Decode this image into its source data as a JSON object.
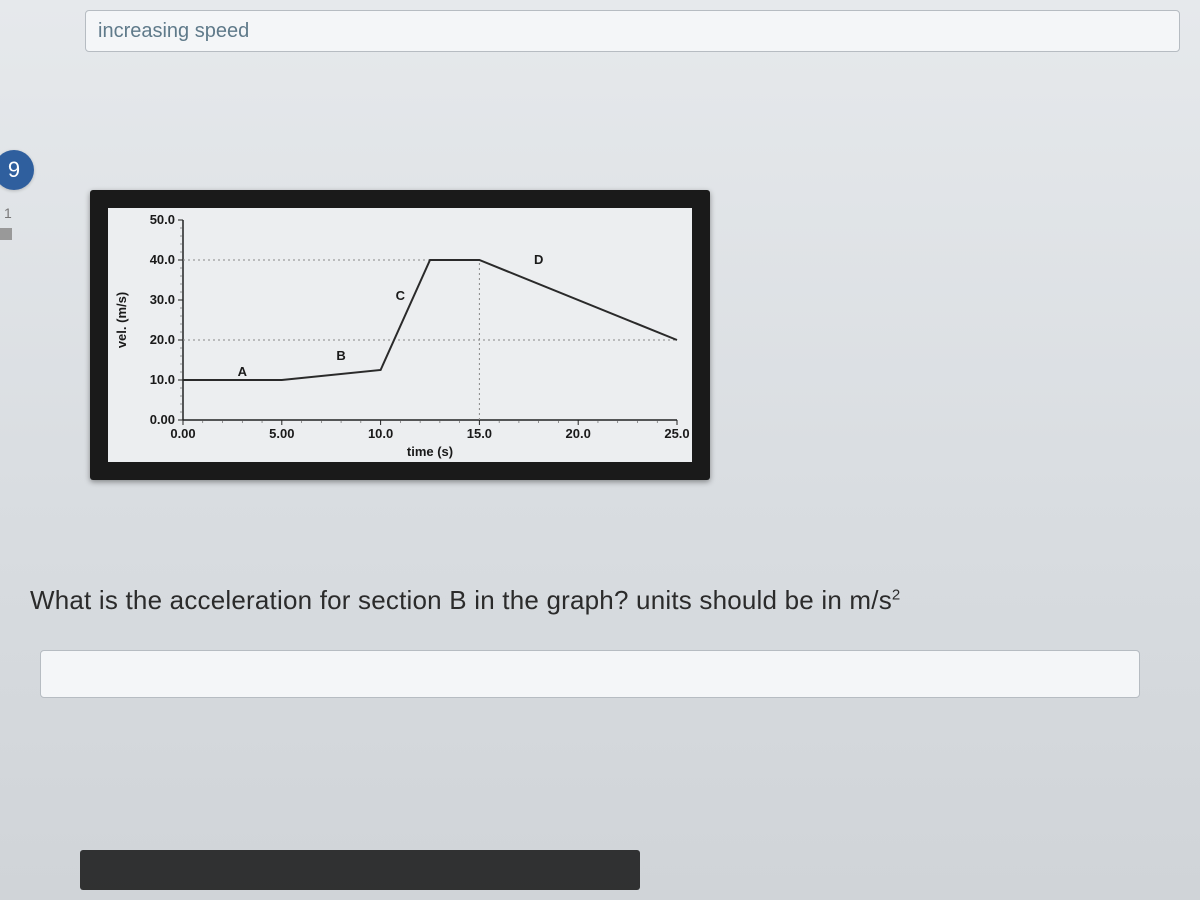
{
  "header": {
    "dropdown_value": "increasing speed"
  },
  "sidebar": {
    "question_number": "9",
    "mark1": "1"
  },
  "question": {
    "text_html": "What is the acceleration for section B in the graph? units should be in m/s<sup>2</sup>"
  },
  "answer": {
    "value": "",
    "placeholder": ""
  },
  "chart_data": {
    "type": "line",
    "xlabel": "time  (s)",
    "ylabel": "vel. (m/s)",
    "xlim": [
      0,
      25
    ],
    "ylim": [
      0,
      50
    ],
    "x_ticks": [
      "0.00",
      "5.00",
      "10.0",
      "15.0",
      "20.0",
      "25.0"
    ],
    "y_ticks": [
      "0.00",
      "10.0",
      "20.0",
      "30.0",
      "40.0",
      "50.0"
    ],
    "grid": false,
    "series": [
      {
        "name": "velocity",
        "x": [
          0,
          5,
          10,
          12.5,
          15,
          25
        ],
        "y": [
          10,
          10,
          12.5,
          40,
          40,
          20
        ]
      }
    ],
    "segments": [
      {
        "label": "A",
        "from_x": 0,
        "to_x": 5,
        "v_start": 10,
        "v_end": 10
      },
      {
        "label": "B",
        "from_x": 5,
        "to_x": 10,
        "v_start": 10,
        "v_end": 12.5
      },
      {
        "label": "C",
        "from_x": 10,
        "to_x": 12.5,
        "v_start": 12.5,
        "v_end": 40
      },
      {
        "label": "D",
        "from_x": 15,
        "to_x": 25,
        "v_start": 40,
        "v_end": 20
      }
    ],
    "annotations": [
      {
        "label": "A",
        "x": 3,
        "y": 11
      },
      {
        "label": "B",
        "x": 8,
        "y": 15
      },
      {
        "label": "C",
        "x": 11,
        "y": 30
      },
      {
        "label": "D",
        "x": 18,
        "y": 39
      }
    ],
    "guide_lines": [
      {
        "type": "h",
        "y": 40,
        "from_x": 0,
        "to_x": 15
      },
      {
        "type": "h",
        "y": 20,
        "from_x": 0,
        "to_x": 25
      },
      {
        "type": "v",
        "x": 15,
        "from_y": 0,
        "to_y": 40
      }
    ]
  }
}
